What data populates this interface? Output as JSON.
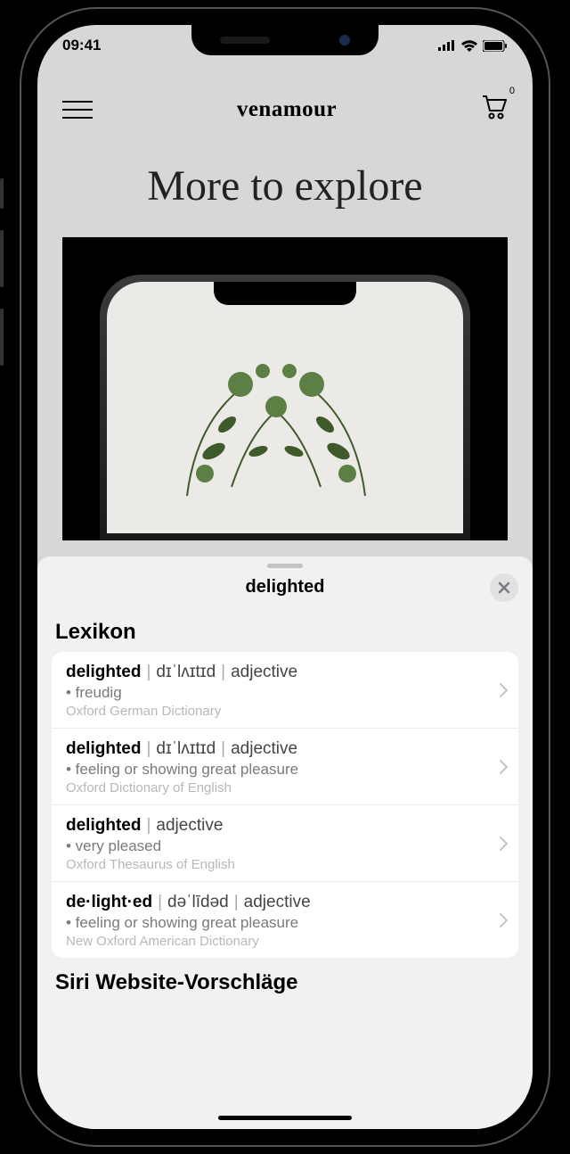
{
  "status": {
    "time": "09:41"
  },
  "site": {
    "brand": "venamour",
    "cart_count": "0",
    "section_title": "More to explore"
  },
  "sheet": {
    "title": "delighted",
    "lexikon_label": "Lexikon",
    "entries": [
      {
        "word": "delighted",
        "ipa": "dɪˈlʌɪtɪd",
        "pos": "adjective",
        "def": "• freudig",
        "source": "Oxford German Dictionary"
      },
      {
        "word": "delighted",
        "ipa": "dɪˈlʌɪtɪd",
        "pos": "adjective",
        "def": "• feeling or showing great pleasure",
        "source": "Oxford Dictionary of English"
      },
      {
        "word": "delighted",
        "ipa": "",
        "pos": "adjective",
        "def": "• very pleased",
        "source": "Oxford Thesaurus of English"
      },
      {
        "word": "de·light·ed",
        "ipa": "dəˈlīdəd",
        "pos": "adjective",
        "def": "• feeling or showing great pleasure",
        "source": "New Oxford American Dictionary"
      }
    ],
    "siri_label": "Siri Website-Vorschläge"
  }
}
